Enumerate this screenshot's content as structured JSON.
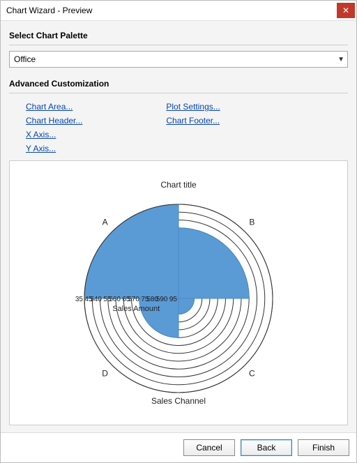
{
  "window": {
    "title": "Chart Wizard - Preview"
  },
  "palette": {
    "heading": "Select Chart Palette",
    "selected": "Office"
  },
  "advanced": {
    "heading": "Advanced Customization",
    "left": {
      "chart_area": "Chart Area...",
      "chart_header": "Chart Header...",
      "x_axis": "X Axis...",
      "y_axis": "Y Axis..."
    },
    "right": {
      "plot_settings": "Plot Settings...",
      "chart_footer": "Chart Footer..."
    }
  },
  "chart": {
    "title": "Chart title",
    "category_label": "Sales Channel",
    "value_label": "Sales Amount",
    "radial_ticks": [
      "35",
      "45",
      "540",
      "55",
      "560",
      "65",
      "570",
      "75",
      "580",
      "590",
      "95"
    ],
    "categories": {
      "a": "A",
      "b": "B",
      "c": "C",
      "d": "D"
    }
  },
  "chart_data": {
    "type": "bar",
    "subtype": "polar-rose",
    "title": "Chart title",
    "xlabel": "Sales Channel",
    "ylabel": "Sales Amount",
    "categories": [
      "A",
      "B",
      "C",
      "D"
    ],
    "values": [
      95,
      80,
      45,
      60
    ],
    "ylim": [
      35,
      95
    ],
    "ticks": [
      35,
      40,
      45,
      50,
      55,
      60,
      65,
      70,
      75,
      80,
      85,
      90,
      95
    ]
  },
  "buttons": {
    "cancel": "Cancel",
    "back": "Back",
    "finish": "Finish"
  }
}
